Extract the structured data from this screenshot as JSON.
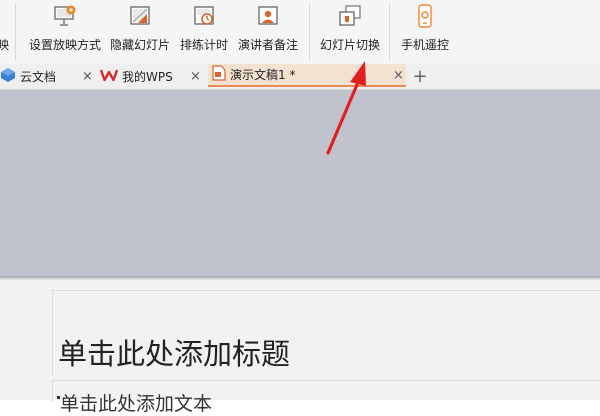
{
  "ribbon": {
    "partial_left_label": "映",
    "buttons": [
      {
        "label": "设置放映方式",
        "icon": "setup-show-icon"
      },
      {
        "label": "隐藏幻灯片",
        "icon": "hide-slide-icon"
      },
      {
        "label": "排练计时",
        "icon": "rehearse-timing-icon"
      },
      {
        "label": "演讲者备注",
        "icon": "speaker-notes-icon"
      },
      {
        "label": "幻灯片切换",
        "icon": "slide-transition-icon"
      },
      {
        "label": "手机遥控",
        "icon": "phone-remote-icon"
      }
    ]
  },
  "tabs": [
    {
      "label": "云文档",
      "icon": "cloud-docs-icon",
      "active": false
    },
    {
      "label": "我的WPS",
      "icon": "wps-logo-icon",
      "active": false
    },
    {
      "label": "演示文稿1 *",
      "icon": "presentation-doc-icon",
      "active": true
    }
  ],
  "tab_close_glyph": "×",
  "tab_add_glyph": "+",
  "slide": {
    "title_placeholder": "单击此处添加标题",
    "body_placeholder": "单击此处添加文本"
  },
  "colors": {
    "accent": "#e88b57",
    "active_tab_bg": "#f4e2d1",
    "workspace": "#c0c3ce",
    "annotation_arrow": "#e02020"
  }
}
